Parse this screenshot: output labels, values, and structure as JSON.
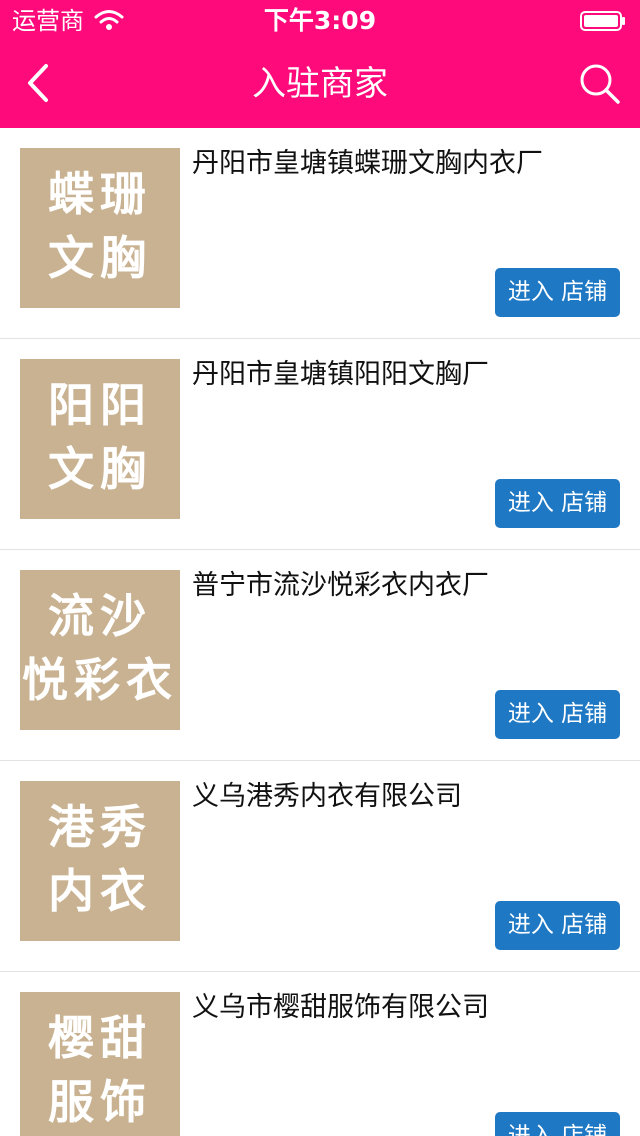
{
  "status": {
    "carrier": "运营商",
    "time": "下午3:09"
  },
  "nav": {
    "title": "入驻商家"
  },
  "colors": {
    "header": "#fe0a7b",
    "button": "#1e78c4",
    "thumb": "#c9b291"
  },
  "shops": [
    {
      "name": "丹阳市皇塘镇蝶珊文胸内衣厂",
      "thumb_line1": "蝶珊",
      "thumb_line2": "文胸",
      "button": "进入 店铺"
    },
    {
      "name": "丹阳市皇塘镇阳阳文胸厂",
      "thumb_line1": "阳阳",
      "thumb_line2": "文胸",
      "button": "进入 店铺"
    },
    {
      "name": "普宁市流沙悦彩衣内衣厂",
      "thumb_line1": "流沙",
      "thumb_line2": "悦彩衣",
      "button": "进入 店铺"
    },
    {
      "name": "义乌港秀内衣有限公司",
      "thumb_line1": "港秀",
      "thumb_line2": "内衣",
      "button": "进入 店铺"
    },
    {
      "name": "义乌市樱甜服饰有限公司",
      "thumb_line1": "樱甜",
      "thumb_line2": "服饰",
      "button": "进入 店铺"
    }
  ]
}
